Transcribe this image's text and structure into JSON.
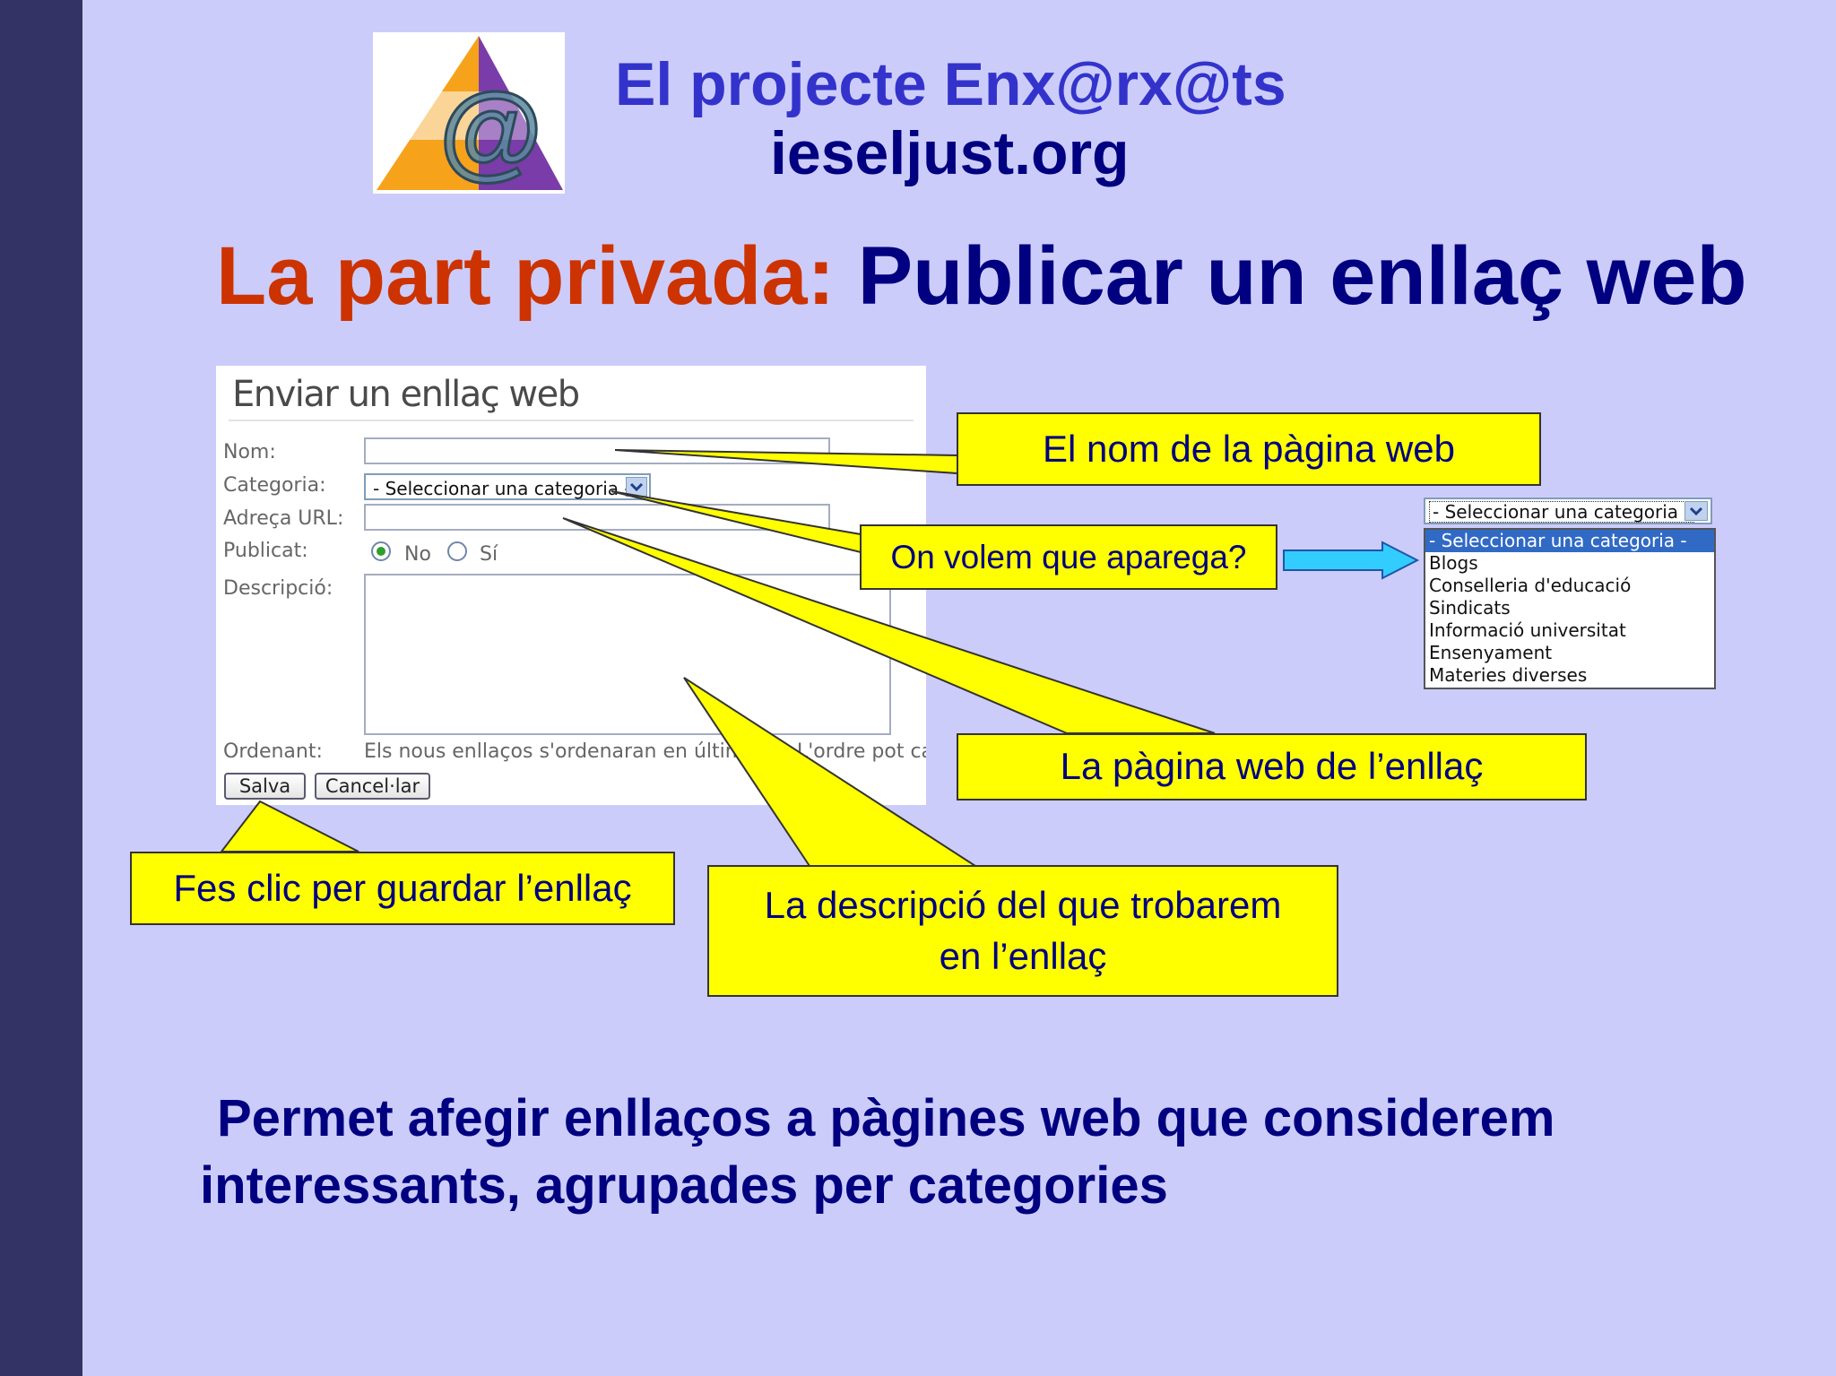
{
  "header": {
    "title": "El projecte Enx@rx@ts",
    "site": "ieseljust.org"
  },
  "slide_title": {
    "part1": "La part privada:",
    "part2": "Publicar un enllaç web"
  },
  "form": {
    "heading": "Enviar un enllaç web",
    "labels": {
      "name": "Nom:",
      "category": "Categoria:",
      "url": "Adreça URL:",
      "published": "Publicat:",
      "description": "Descripció:",
      "order": "Ordenant:"
    },
    "fields": {
      "name_value": "",
      "url_value": "",
      "description_value": ""
    },
    "category_select": "- Seleccionar una categoria -",
    "published_options": [
      {
        "label": "No",
        "checked": true
      },
      {
        "label": "Sí",
        "checked": false
      }
    ],
    "order_text": "Els nous enllaços s'ordenaran en últim lloc. L'ordre pot canviar-se",
    "buttons": {
      "save": "Salva",
      "cancel": "Cancel·lar"
    }
  },
  "callouts": {
    "name": "El nom de la pàgina web",
    "category": "On volem que aparega?",
    "url": "La pàgina web de l’enllaç",
    "save": "Fes clic per guardar l’enllaç",
    "description_line1": "La descripció del que trobarem",
    "description_line2": "en l’enllaç"
  },
  "category_dropdown": {
    "selected": "- Seleccionar una categoria -",
    "options": [
      "- Seleccionar una categoria -",
      "Blogs",
      "Conselleria d'educació",
      "Sindicats",
      "Informació universitat",
      "Ensenyament",
      "Materies diverses"
    ]
  },
  "footer": {
    "line1": "Permet afegir enllaços a pàgines web que considerem",
    "line2": "interessants, agrupades per categories"
  },
  "colors": {
    "background": "#ccccfa",
    "sidebar": "#333366",
    "callout_fill": "#ffff00",
    "title_red": "#cc3300",
    "title_blue": "#000080",
    "header_blue": "#3333cc",
    "arrow": "#33ccff"
  }
}
